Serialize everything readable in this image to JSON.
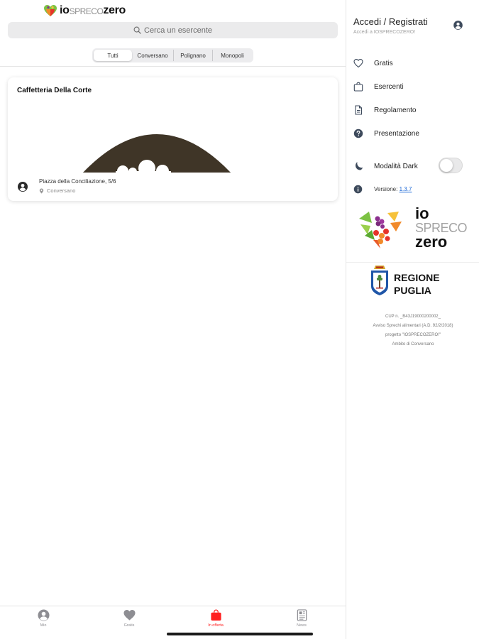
{
  "header": {
    "logo_io": "io",
    "logo_spreco": "SPRECO",
    "logo_zero": "zero"
  },
  "search": {
    "placeholder": "Cerca un esercente"
  },
  "filters": {
    "items": [
      {
        "label": "Tutti",
        "active": true
      },
      {
        "label": "Conversano",
        "active": false
      },
      {
        "label": "Polignano",
        "active": false
      },
      {
        "label": "Monopoli",
        "active": false
      }
    ]
  },
  "listing": {
    "cards": [
      {
        "title": "Caffetteria Della Corte",
        "address": "Piazza della Conciliazione, 5/6",
        "city": "Conversano"
      }
    ]
  },
  "tabbar": {
    "items": [
      {
        "label": "Mio",
        "icon": "user-circle-icon",
        "active": false
      },
      {
        "label": "Gratis",
        "icon": "heart-icon",
        "active": false
      },
      {
        "label": "In offerta",
        "icon": "bag-icon",
        "active": true
      },
      {
        "label": "News",
        "icon": "newspaper-icon",
        "active": false
      }
    ],
    "active_color": "#ff1f1f"
  },
  "side_menu": {
    "title": "Accedi / Registrati",
    "subtitle": "Accedi a IOSPRECOZERO!",
    "items": [
      {
        "label": "Gratis",
        "icon": "heart-outline-icon"
      },
      {
        "label": "Esercenti",
        "icon": "bag-outline-icon"
      },
      {
        "label": "Regolamento",
        "icon": "document-icon"
      },
      {
        "label": "Presentazione",
        "icon": "help-circle-icon"
      }
    ],
    "dark_mode": {
      "label": "Modalità Dark",
      "icon": "moon-icon",
      "enabled": false
    },
    "version": {
      "label": "Versione:",
      "value": "1.3.7",
      "icon": "info-icon"
    },
    "brand": {
      "io": "io",
      "spreco": "SPRECO",
      "zero": "zero"
    },
    "region": {
      "line1": "REGIONE",
      "line2": "PUGLIA"
    },
    "fine_print": [
      "CUP n. _B43J19000200002_",
      "Avviso Sprechi alimentari (A.D. 92/2/2018)",
      "progetto \"IOSPRECOZERO!\"",
      "Ambito di Conversano"
    ]
  }
}
